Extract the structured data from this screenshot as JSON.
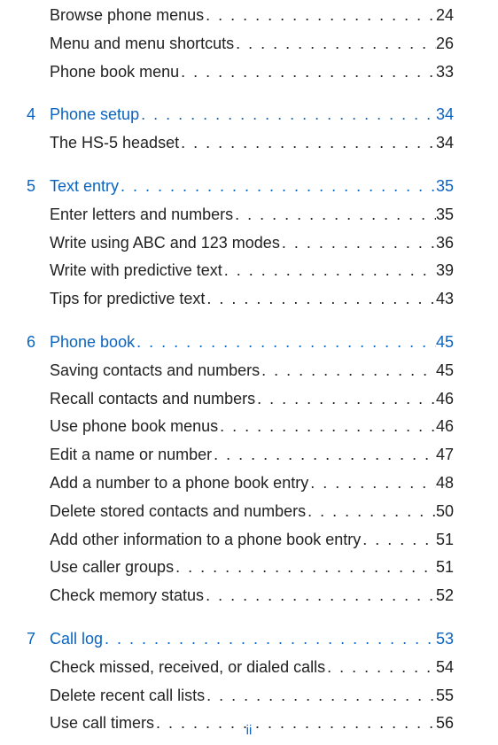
{
  "footer": {
    "page_label": "ii"
  },
  "toc": {
    "pre_items": [
      {
        "title": "Browse phone menus",
        "page": "24"
      },
      {
        "title": "Menu and menu shortcuts",
        "page": "26"
      },
      {
        "title": "Phone book menu",
        "page": "33"
      }
    ],
    "sections": [
      {
        "number": "4",
        "title": "Phone setup",
        "page": "34",
        "items": [
          {
            "title": "The HS-5 headset",
            "page": "34"
          }
        ]
      },
      {
        "number": "5",
        "title": "Text entry",
        "page": "35",
        "items": [
          {
            "title": "Enter letters and numbers",
            "page": "35"
          },
          {
            "title": "Write using ABC and 123 modes",
            "page": "36"
          },
          {
            "title": "Write with predictive text",
            "page": "39"
          },
          {
            "title": "Tips for predictive text",
            "page": "43"
          }
        ]
      },
      {
        "number": "6",
        "title": "Phone book",
        "page": "45",
        "items": [
          {
            "title": "Saving contacts and numbers",
            "page": "45"
          },
          {
            "title": "Recall contacts and numbers",
            "page": "46"
          },
          {
            "title": "Use phone book menus",
            "page": "46"
          },
          {
            "title": "Edit a name or number",
            "page": "47"
          },
          {
            "title": "Add a number to a phone book entry",
            "page": "48"
          },
          {
            "title": "Delete stored contacts and numbers",
            "page": "50"
          },
          {
            "title": "Add other information to a phone book entry",
            "page": "51"
          },
          {
            "title": "Use caller groups",
            "page": "51"
          },
          {
            "title": "Check memory status",
            "page": "52"
          }
        ]
      },
      {
        "number": "7",
        "title": "Call log",
        "page": "53",
        "items": [
          {
            "title": "Check missed, received, or dialed calls",
            "page": "54"
          },
          {
            "title": "Delete recent call lists",
            "page": "55"
          },
          {
            "title": "Use call timers",
            "page": "56"
          }
        ]
      }
    ]
  }
}
